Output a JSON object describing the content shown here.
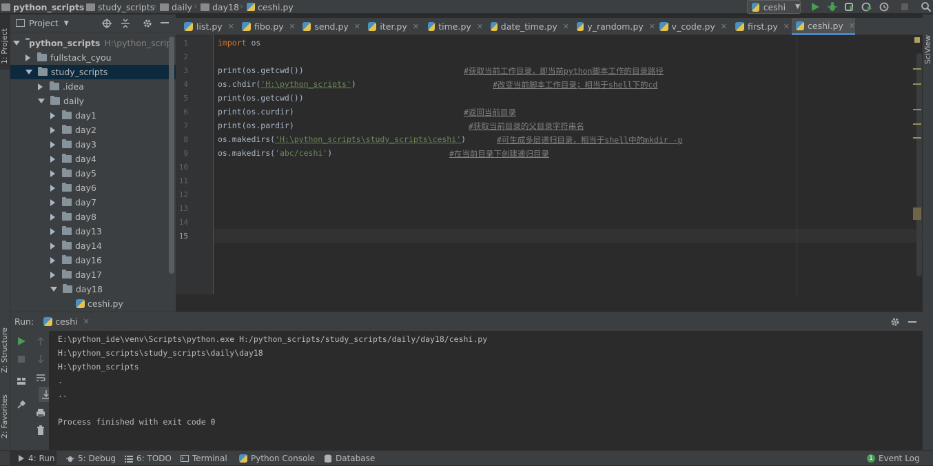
{
  "breadcrumb": {
    "items": [
      "python_scripts",
      "study_scripts",
      "daily",
      "day18",
      "ceshi.py"
    ]
  },
  "toolbar": {
    "run_config": "ceshi"
  },
  "side_tabs": {
    "project": "1: Project",
    "structure": "Z: Structure",
    "favorites": "2: Favorites",
    "sciview": "SciView"
  },
  "project_panel": {
    "title": "Project",
    "tree": [
      {
        "label": "python_scripts",
        "hint": "H:\\python_scrip",
        "bold": true
      },
      {
        "label": "fullstack_cyou"
      },
      {
        "label": "study_scripts",
        "selected": true
      },
      {
        "label": ".idea"
      },
      {
        "label": "daily"
      },
      {
        "label": "day1"
      },
      {
        "label": "day2"
      },
      {
        "label": "day3"
      },
      {
        "label": "day4"
      },
      {
        "label": "day5"
      },
      {
        "label": "day6"
      },
      {
        "label": "day7"
      },
      {
        "label": "day8"
      },
      {
        "label": "day13"
      },
      {
        "label": "day14"
      },
      {
        "label": "day16"
      },
      {
        "label": "day17"
      },
      {
        "label": "day18"
      },
      {
        "label": "ceshi.py"
      }
    ]
  },
  "tabs": [
    "list.py",
    "fibo.py",
    "send.py",
    "iter.py",
    "time.py",
    "date_time.py",
    "y_random.py",
    "v_code.py",
    "first.py",
    "ceshi.py"
  ],
  "editor": {
    "line_numbers": [
      "1",
      "2",
      "3",
      "4",
      "5",
      "6",
      "7",
      "8",
      "9",
      "10",
      "11",
      "12",
      "13",
      "14",
      "15"
    ],
    "lines": [
      {
        "kw": "import",
        "rest": " os"
      },
      {},
      {
        "pre": "print(os.getcwd())",
        "comment": "#获取当前工作目录，即当前python脚本工作的目录路径"
      },
      {
        "pre": "os.chdir(",
        "str": "'H:\\python_scripts'",
        "post": ")",
        "comment": "#改变当前脚本工作目录；相当于shell下的cd"
      },
      {
        "pre": "print(os.getcwd())"
      },
      {
        "pre": "print(os.curdir)",
        "comment": "#返回当前目录"
      },
      {
        "pre": "print(os.pardir)",
        "comment": "#获取当前目录的父目录字符串名"
      },
      {
        "pre": "os.makedirs(",
        "str": "'H:\\python_scripts\\study_scripts\\ceshi'",
        "post": ")",
        "comment": "#可生成多层递归目录，相当于shell中的mkdir -p"
      },
      {
        "pre": "os.makedirs(",
        "str": "'abc/ceshi'",
        "post": ")",
        "comment": "#在当前目录下创建递归目录"
      }
    ]
  },
  "run_panel": {
    "label": "Run:",
    "tab": "ceshi",
    "output": [
      "E:\\python_ide\\venv\\Scripts\\python.exe H:/python_scripts/study_scripts/daily/day18/ceshi.py",
      "H:\\python_scripts\\study_scripts\\daily\\day18",
      "H:\\python_scripts",
      ".",
      "..",
      "",
      "Process finished with exit code 0"
    ]
  },
  "statusbar": {
    "run": "4: Run",
    "debug": "5: Debug",
    "todo": "6: TODO",
    "terminal": "Terminal",
    "python_console": "Python Console",
    "database": "Database",
    "event_log": "Event Log",
    "event_count": "1"
  }
}
